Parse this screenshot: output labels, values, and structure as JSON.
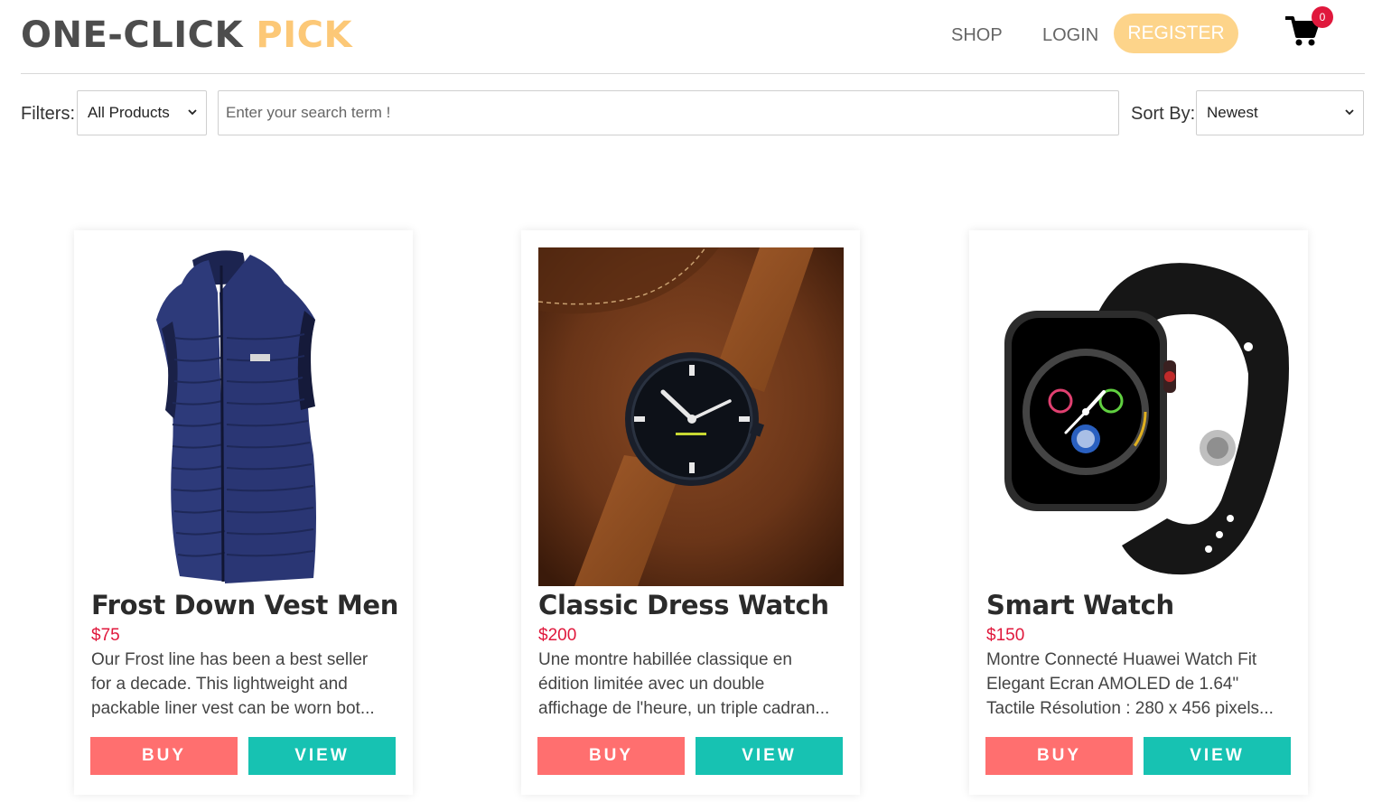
{
  "brand": {
    "part1": "ONE-CLICK",
    "part2": "PICK"
  },
  "nav": {
    "shop": "SHOP",
    "login": "LOGIN",
    "register": "REGISTER"
  },
  "cart": {
    "count": "0",
    "icon": "shopping-cart-icon"
  },
  "filters": {
    "label": "Filters:",
    "category_selected": "All Products",
    "search_placeholder": "Enter your search term !",
    "sort_label": "Sort By:",
    "sort_selected": "Newest"
  },
  "colors": {
    "brand_accent": "#fcc877",
    "register_button": "#fdd48a",
    "price": "#e0183c",
    "buy_button": "#ff6f6f",
    "view_button": "#17c2b2",
    "badge": "#e0183c"
  },
  "products": [
    {
      "title": "Frost Down Vest Men",
      "price": "$75",
      "desc": [
        "Our Frost line has been a best seller",
        "for a decade. This lightweight and",
        "packable liner vest can be worn bot..."
      ],
      "buy": "BUY",
      "view": "VIEW"
    },
    {
      "title": "Classic Dress Watch",
      "price": "$200",
      "desc": [
        "Une montre habillée classique en",
        "édition limitée avec un double",
        "affichage de l'heure, un triple cadran..."
      ],
      "buy": "BUY",
      "view": "VIEW"
    },
    {
      "title": "Smart Watch",
      "price": "$150",
      "desc": [
        "Montre Connecté Huawei Watch Fit",
        "Elegant Ecran AMOLED de 1.64\"",
        "Tactile Résolution : 280 x 456 pixels..."
      ],
      "buy": "BUY",
      "view": "VIEW"
    }
  ]
}
